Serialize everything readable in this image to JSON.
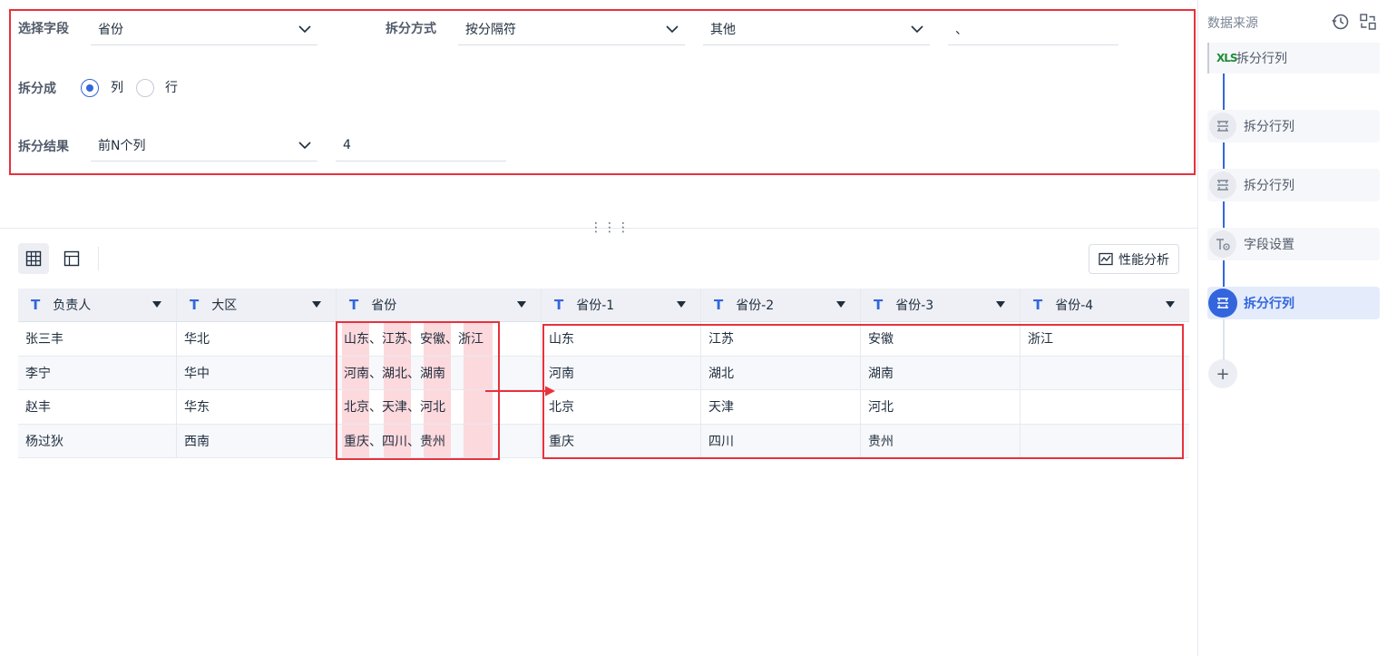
{
  "config": {
    "field_label": "选择字段",
    "field_value": "省份",
    "method_label": "拆分方式",
    "method_value": "按分隔符",
    "delimiter_type": "其他",
    "delimiter_value": "、",
    "split_into_label": "拆分成",
    "option_column": "列",
    "option_row": "行",
    "selected_option": "列",
    "result_label": "拆分结果",
    "result_mode": "前N个列",
    "result_count": "4"
  },
  "toolbar": {
    "perf_label": "性能分析"
  },
  "table": {
    "columns": [
      "负责人",
      "大区",
      "省份",
      "省份-1",
      "省份-2",
      "省份-3",
      "省份-4"
    ],
    "rows": [
      [
        "张三丰",
        "华北",
        "山东、江苏、安徽、浙江",
        "山东",
        "江苏",
        "安徽",
        "浙江"
      ],
      [
        "李宁",
        "华中",
        "河南、湖北、湖南",
        "河南",
        "湖北",
        "湖南",
        ""
      ],
      [
        "赵丰",
        "华东",
        "北京、天津、河北",
        "北京",
        "天津",
        "河北",
        ""
      ],
      [
        "杨过狄",
        "西南",
        "重庆、四川、贵州",
        "重庆",
        "四川",
        "贵州",
        ""
      ]
    ]
  },
  "sidebar": {
    "title": "数据来源",
    "steps": [
      {
        "label": "拆分行列",
        "kind": "source-xls",
        "icon": "XLS"
      },
      {
        "label": "拆分行列",
        "kind": "split"
      },
      {
        "label": "拆分行列",
        "kind": "split"
      },
      {
        "label": "字段设置",
        "kind": "field-settings"
      },
      {
        "label": "拆分行列",
        "kind": "split",
        "active": true
      }
    ],
    "add_label": "+"
  },
  "colors": {
    "accent": "#3366dd",
    "highlight_box": "#e8313c",
    "highlight_fill": "#fcd9dd",
    "header_bg": "#eef0f5"
  }
}
